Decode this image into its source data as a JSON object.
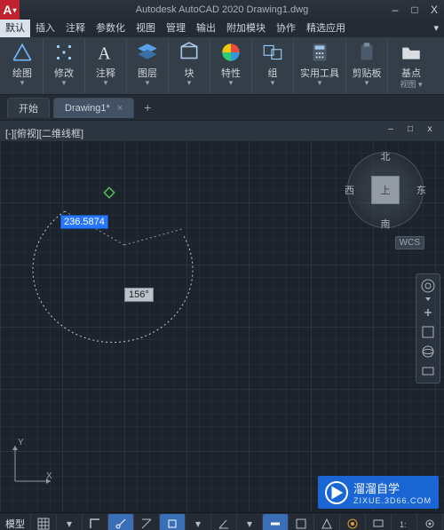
{
  "app": {
    "icon_letter": "A",
    "title_text": "Autodesk AutoCAD 2020   Drawing1.dwg"
  },
  "window_controls": {
    "minimize": "–",
    "maximize": "□",
    "close": "X"
  },
  "menu": {
    "items": [
      "默认",
      "插入",
      "注释",
      "参数化",
      "视图",
      "管理",
      "输出",
      "附加模块",
      "协作",
      "精选应用"
    ],
    "overflow": "▾",
    "active_index": 0
  },
  "ribbon": {
    "panels": [
      {
        "icon": "draw",
        "label": "绘图",
        "chev": true
      },
      {
        "icon": "modify",
        "label": "修改",
        "chev": true
      },
      {
        "icon": "annot",
        "label": "注释",
        "chev": true
      },
      {
        "icon": "layers",
        "label": "图层",
        "chev": true
      },
      {
        "icon": "block",
        "label": "块",
        "chev": true
      },
      {
        "icon": "props",
        "label": "特性",
        "chev": true
      },
      {
        "icon": "group",
        "label": "组",
        "chev": true
      },
      {
        "icon": "utils",
        "label": "实用工具",
        "chev": true
      },
      {
        "icon": "clip",
        "label": "剪贴板",
        "chev": true
      },
      {
        "icon": "base",
        "label": "基点",
        "chev": false,
        "sub": "视图 ▾"
      }
    ]
  },
  "tabs": {
    "start": "开始",
    "doc": "Drawing1*",
    "plus": "+"
  },
  "viewport": {
    "label": "[-][俯视][二维线框]",
    "min": "–",
    "max": "□",
    "close": "x"
  },
  "drawing": {
    "distance_value": "236.5874",
    "angle_value": "156°"
  },
  "ucs": {
    "x": "X",
    "y": "Y"
  },
  "viewcube": {
    "top": "上",
    "n": "北",
    "s": "南",
    "e": "东",
    "w": "西",
    "wcs": "WCS"
  },
  "status": {
    "model": "模型",
    "icons_left": [
      "grid",
      "dropdown",
      "sep",
      "ortho",
      "polar",
      "iso",
      "snap",
      "dropdown2",
      "angle",
      "dropdown3",
      "sep2",
      "lineweight"
    ],
    "icons_right": [
      "r1",
      "r2",
      "r3",
      "r4",
      "r5",
      "r6",
      "r7",
      "r8",
      "r9",
      "menu"
    ]
  },
  "watermark": {
    "title": "溜溜自学",
    "sub": "ZIXUE.3D66.COM"
  }
}
